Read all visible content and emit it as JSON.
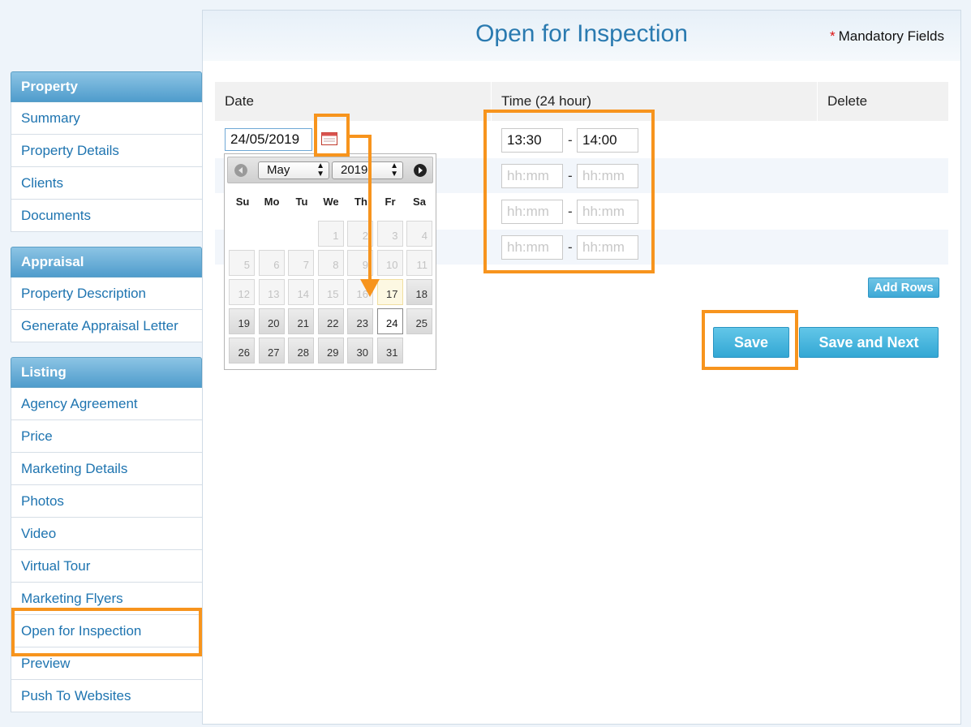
{
  "sidebar": {
    "property": {
      "title": "Property",
      "items": [
        "Summary",
        "Property Details",
        "Clients",
        "Documents"
      ]
    },
    "appraisal": {
      "title": "Appraisal",
      "items": [
        "Property Description",
        "Generate Appraisal Letter"
      ]
    },
    "listing": {
      "title": "Listing",
      "items": [
        "Agency Agreement",
        "Price",
        "Marketing Details",
        "Photos",
        "Video",
        "Virtual Tour",
        "Marketing Flyers",
        "Open for Inspection",
        "Preview",
        "Push To Websites"
      ],
      "active": "Open for Inspection"
    }
  },
  "header": {
    "title": "Open for Inspection",
    "mandatory_star": "*",
    "mandatory_text": "Mandatory Fields"
  },
  "table": {
    "col_date": "Date",
    "col_time": "Time (24 hour)",
    "col_delete": "Delete",
    "date_value": "24/05/2019",
    "time_sep": "-",
    "rows": [
      {
        "start": "13:30",
        "end": "14:00"
      },
      {
        "start_placeholder": "hh:mm",
        "end_placeholder": "hh:mm"
      },
      {
        "start_placeholder": "hh:mm",
        "end_placeholder": "hh:mm"
      },
      {
        "start_placeholder": "hh:mm",
        "end_placeholder": "hh:mm"
      }
    ]
  },
  "buttons": {
    "add_rows": "Add Rows",
    "save": "Save",
    "save_next": "Save and Next"
  },
  "calendar": {
    "month": "May",
    "year": "2019",
    "weekdays": [
      "Su",
      "Mo",
      "Tu",
      "We",
      "Th",
      "Fr",
      "Sa"
    ],
    "first_weekday_index": 3,
    "days_in_month": 31,
    "today": 17,
    "selected": 24,
    "first_enabled_day": 17
  },
  "colors": {
    "highlight": "#f7941d",
    "accent": "#2a7ab0",
    "button": "#3aa9d6"
  }
}
